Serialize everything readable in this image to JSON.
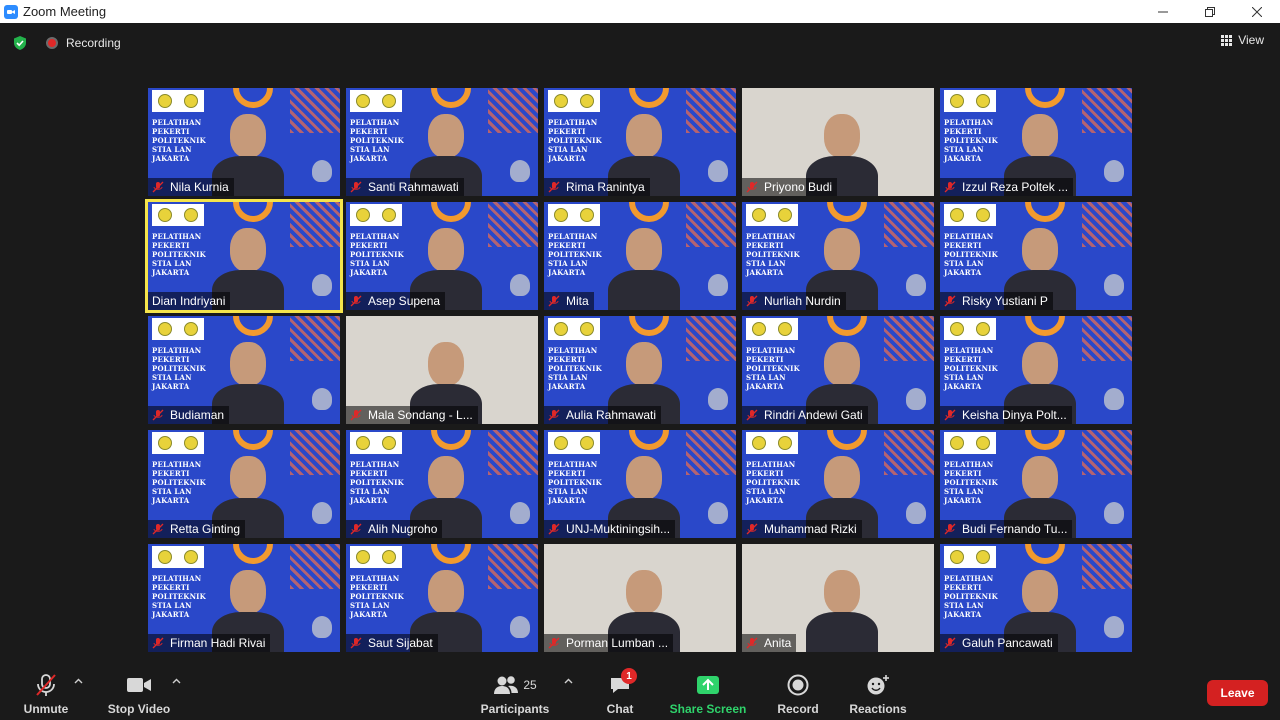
{
  "window": {
    "title": "Zoom Meeting"
  },
  "topbar": {
    "recording_label": "Recording",
    "view_label": "View"
  },
  "participants": [
    {
      "name": "Nila Kurnia",
      "muted": true,
      "type": "banner"
    },
    {
      "name": "Santi Rahmawati",
      "muted": true,
      "type": "banner"
    },
    {
      "name": "Rima Ranintya",
      "muted": true,
      "type": "banner"
    },
    {
      "name": "Priyono Budi",
      "muted": true,
      "type": "photo"
    },
    {
      "name": "Izzul Reza Poltek ...",
      "muted": true,
      "type": "banner"
    },
    {
      "name": "Dian Indriyani",
      "muted": false,
      "type": "banner",
      "speaking": true
    },
    {
      "name": "Asep Supena",
      "muted": true,
      "type": "banner"
    },
    {
      "name": "Mita",
      "muted": true,
      "type": "banner"
    },
    {
      "name": "Nurliah Nurdin",
      "muted": true,
      "type": "banner"
    },
    {
      "name": "Risky Yustiani P",
      "muted": true,
      "type": "banner"
    },
    {
      "name": "Budiaman",
      "muted": true,
      "type": "banner"
    },
    {
      "name": "Mala Sondang - L...",
      "muted": true,
      "type": "photo"
    },
    {
      "name": "Aulia Rahmawati",
      "muted": true,
      "type": "banner"
    },
    {
      "name": "Rindri Andewi Gati",
      "muted": true,
      "type": "banner"
    },
    {
      "name": "Keisha Dinya Polt...",
      "muted": true,
      "type": "banner"
    },
    {
      "name": "Retta Ginting",
      "muted": true,
      "type": "banner"
    },
    {
      "name": "Alih Nugroho",
      "muted": true,
      "type": "banner"
    },
    {
      "name": "UNJ-Muktiningsih...",
      "muted": true,
      "type": "banner"
    },
    {
      "name": "Muhammad Rizki",
      "muted": true,
      "type": "banner"
    },
    {
      "name": "Budi Fernando Tu...",
      "muted": true,
      "type": "banner"
    },
    {
      "name": "Firman Hadi Rivai",
      "muted": true,
      "type": "banner"
    },
    {
      "name": "Saut Sijabat",
      "muted": true,
      "type": "banner"
    },
    {
      "name": "Porman Lumban ...",
      "muted": true,
      "type": "photo"
    },
    {
      "name": "Anita",
      "muted": true,
      "type": "photo"
    },
    {
      "name": "Galuh Pancawati",
      "muted": true,
      "type": "banner"
    }
  ],
  "banner_text": [
    "PELATIHAN",
    "PEKERTI",
    "POLITEKNIK",
    "STIA LAN",
    "JAKARTA"
  ],
  "toolbar": {
    "unmute_label": "Unmute",
    "stop_video_label": "Stop Video",
    "participants_label": "Participants",
    "participants_count": "25",
    "chat_label": "Chat",
    "chat_badge": "1",
    "share_label": "Share Screen",
    "record_label": "Record",
    "reactions_label": "Reactions",
    "leave_label": "Leave"
  },
  "colors": {
    "accent_green": "#2fd36b",
    "leave_red": "#d42121",
    "speaker_outline": "#f5e44b",
    "banner_blue": "#2a48c9"
  }
}
